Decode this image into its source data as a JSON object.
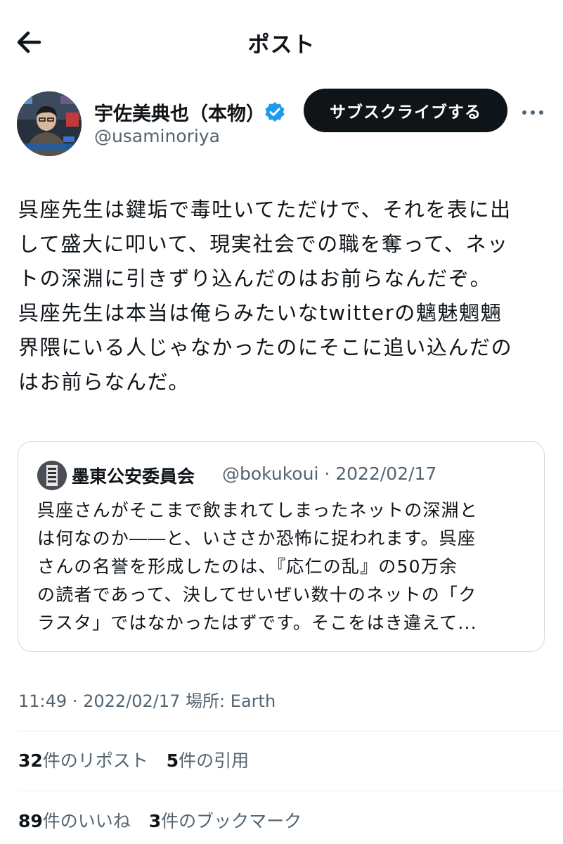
{
  "header": {
    "title": "ポスト"
  },
  "author": {
    "display_name": "宇佐美典也（本物）",
    "handle": "@usaminoriya",
    "subscribe_label": "サブスクライブする"
  },
  "tweet": {
    "lines": [
      "呉座先生は鍵垢で毒吐いてただけで、それを表に出",
      "して盛大に叩いて、現実社会での職を奪って、ネッ",
      "トの深淵に引きずり込んだのはお前らなんだぞ。",
      "呉座先生は本当は俺らみたいなtwitterの魑魅魍魎",
      "界隈にいる人じゃなかったのにそこに追い込んだの",
      "はお前らなんだ。"
    ]
  },
  "quote": {
    "name": "墨東公安委員会",
    "handle": "@bokukoui",
    "separator": "·",
    "date": "2022/02/17",
    "lines": [
      "呉座さんがそこまで飲まれてしまったネットの深淵と",
      "は何なのか――と、いささか恐怖に捉われます。呉座",
      "さんの名誉を形成したのは、『応仁の乱』の50万余",
      "の読者であって、決してせいぜい数十のネットの「ク",
      "ラスタ」ではなかったはずです。そこをはき違えて..."
    ]
  },
  "meta": {
    "time": "11:49",
    "separator": "·",
    "date": "2022/02/17",
    "location_label": "場所:",
    "location": "Earth"
  },
  "stats": {
    "reposts_count": "32",
    "reposts_label": "件のリポスト",
    "quotes_count": "5",
    "quotes_label": "件の引用",
    "likes_count": "89",
    "likes_label": "件のいいね",
    "bookmarks_count": "3",
    "bookmarks_label": "件のブックマーク"
  },
  "colors": {
    "text": "#0f1419",
    "secondary": "#536471",
    "verified": "#1d9bf0",
    "border": "#cfd9de",
    "button_bg": "#0f1419"
  },
  "icons": {
    "back": "arrow-left-icon",
    "verified": "verified-badge-icon",
    "more": "more-horizontal-icon"
  }
}
